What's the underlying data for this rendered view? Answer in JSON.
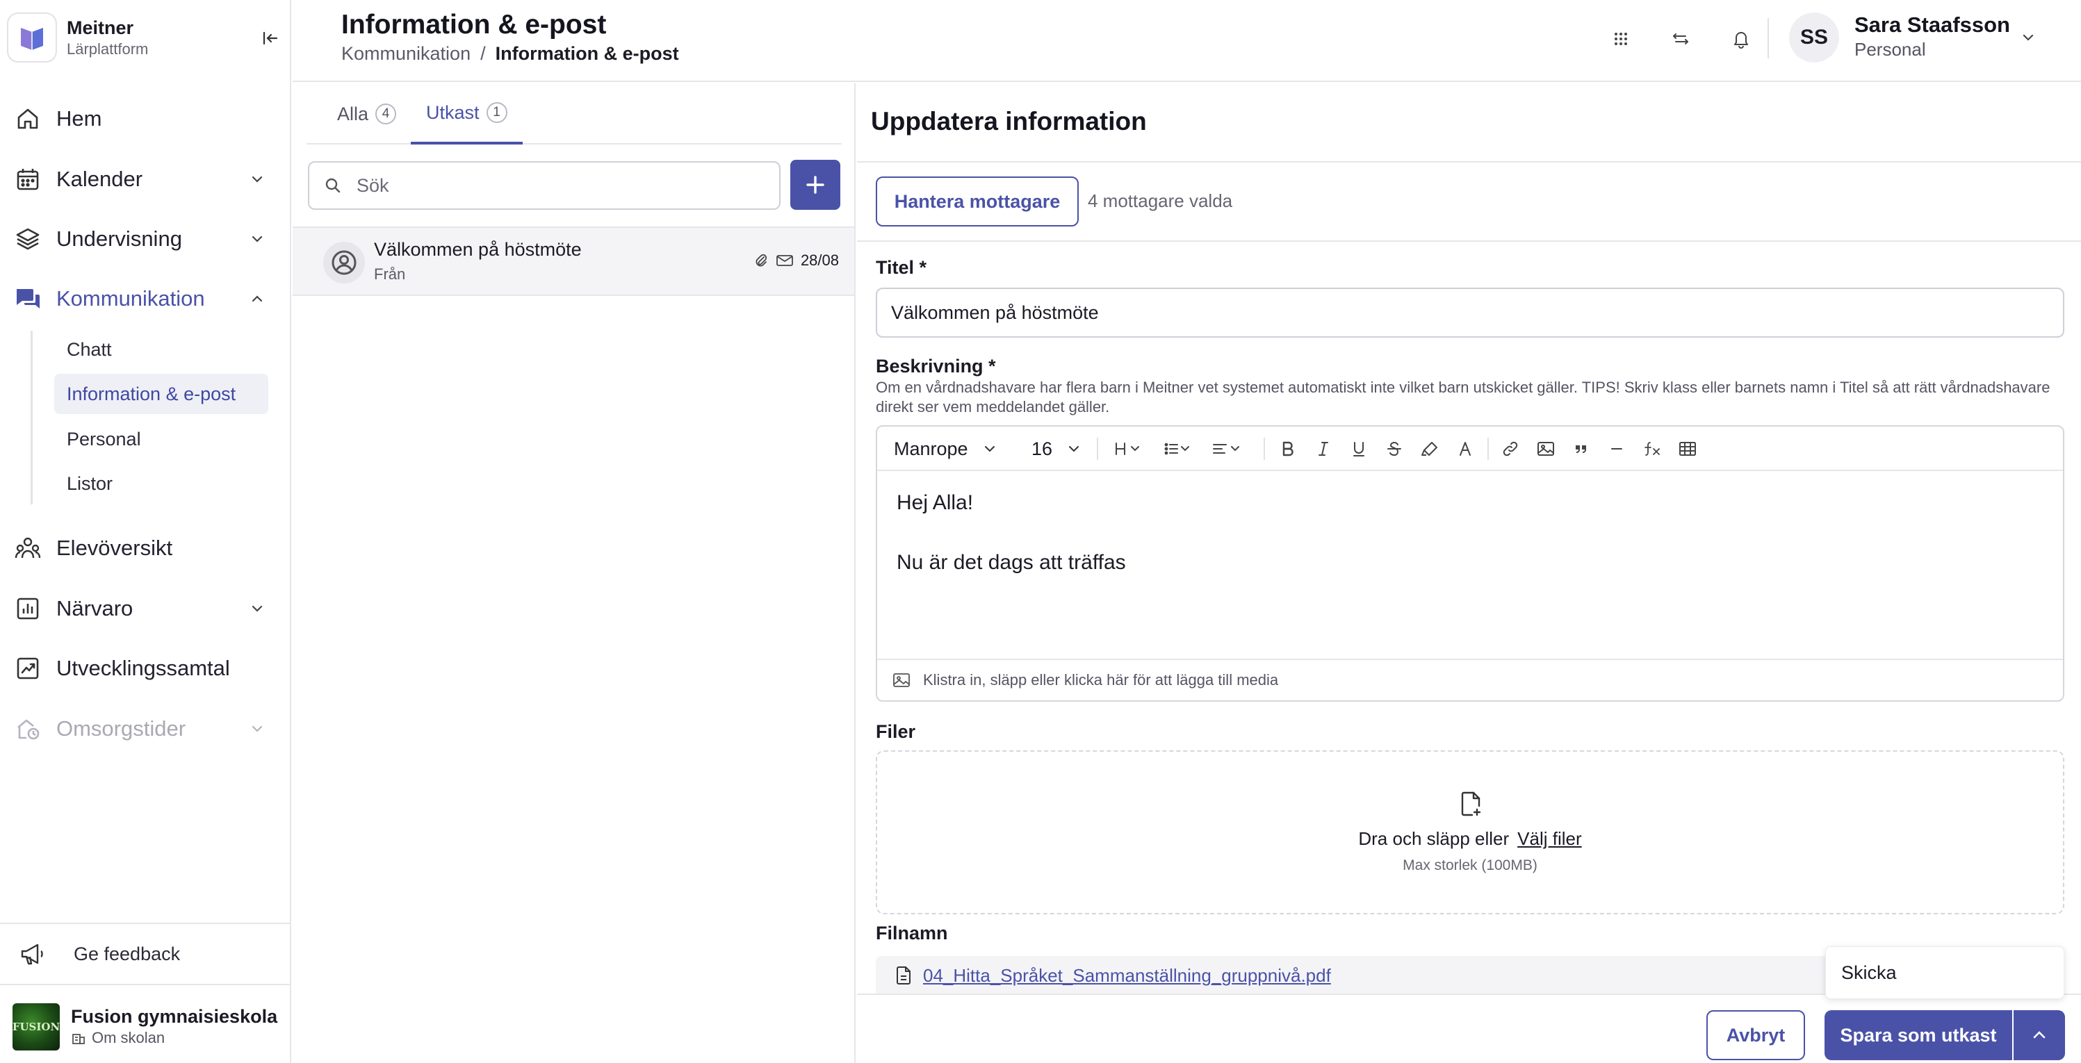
{
  "brand": {
    "name": "Meitner",
    "subtitle": "Lärplattform"
  },
  "nav": {
    "home": "Hem",
    "calendar": "Kalender",
    "teaching": "Undervisning",
    "communication": "Kommunikation",
    "communication_sub": [
      "Chatt",
      "Information & e-post",
      "Personal",
      "Listor"
    ],
    "students": "Elevöversikt",
    "attendance": "Närvaro",
    "development": "Utvecklingssamtal",
    "care_times": "Omsorgstider"
  },
  "feedback": {
    "label": "Ge feedback"
  },
  "school": {
    "name": "Fusion gymnaisieskola",
    "link": "Om skolan",
    "logo_text": "FUSION"
  },
  "header": {
    "title": "Information & e-post",
    "breadcrumb": {
      "parent": "Kommunikation",
      "separator": "/",
      "current": "Information & e-post"
    }
  },
  "user": {
    "initials": "SS",
    "name": "Sara Staafsson",
    "role": "Personal"
  },
  "list": {
    "tabs": [
      {
        "label": "Alla",
        "count": "4"
      },
      {
        "label": "Utkast",
        "count": "1"
      }
    ],
    "search_placeholder": "Sök",
    "messages": [
      {
        "title": "Välkommen på höstmöte",
        "from": "Från",
        "date": "28/08"
      }
    ]
  },
  "detail": {
    "title": "Uppdatera information",
    "recipients_button": "Hantera mottagare",
    "recipients_count": "4 mottagare valda",
    "title_label": "Titel *",
    "title_value": "Välkommen på höstmöte",
    "description_label": "Beskrivning *",
    "description_hint": "Om en vårdnadshavare har flera barn i Meitner vet systemet automatiskt inte vilket barn utskicket gäller. TIPS! Skriv klass eller barnets namn i Titel så att rätt vårdnadshavare direkt ser vem meddelandet gäller.",
    "editor": {
      "font": "Manrope",
      "size": "16",
      "body_line1": "Hej Alla!",
      "body_line2": "Nu är det dags att träffas",
      "media_hint": "Klistra in, släpp eller klicka här för att lägga till media"
    },
    "files_label": "Filer",
    "dropzone_text": "Dra och släpp eller",
    "dropzone_link": "Välj filer",
    "dropzone_max": "Max storlek (100MB)",
    "filename_label": "Filnamn",
    "file_name": "04_Hitta_Språket_Sammanställning_gruppnivå.pdf",
    "cancel": "Avbryt",
    "save_draft": "Spara som utkast",
    "send": "Skicka"
  },
  "colors": {
    "accent": "#4a52a8",
    "active_bg": "#eef0f6",
    "border": "#e6e6ea"
  }
}
